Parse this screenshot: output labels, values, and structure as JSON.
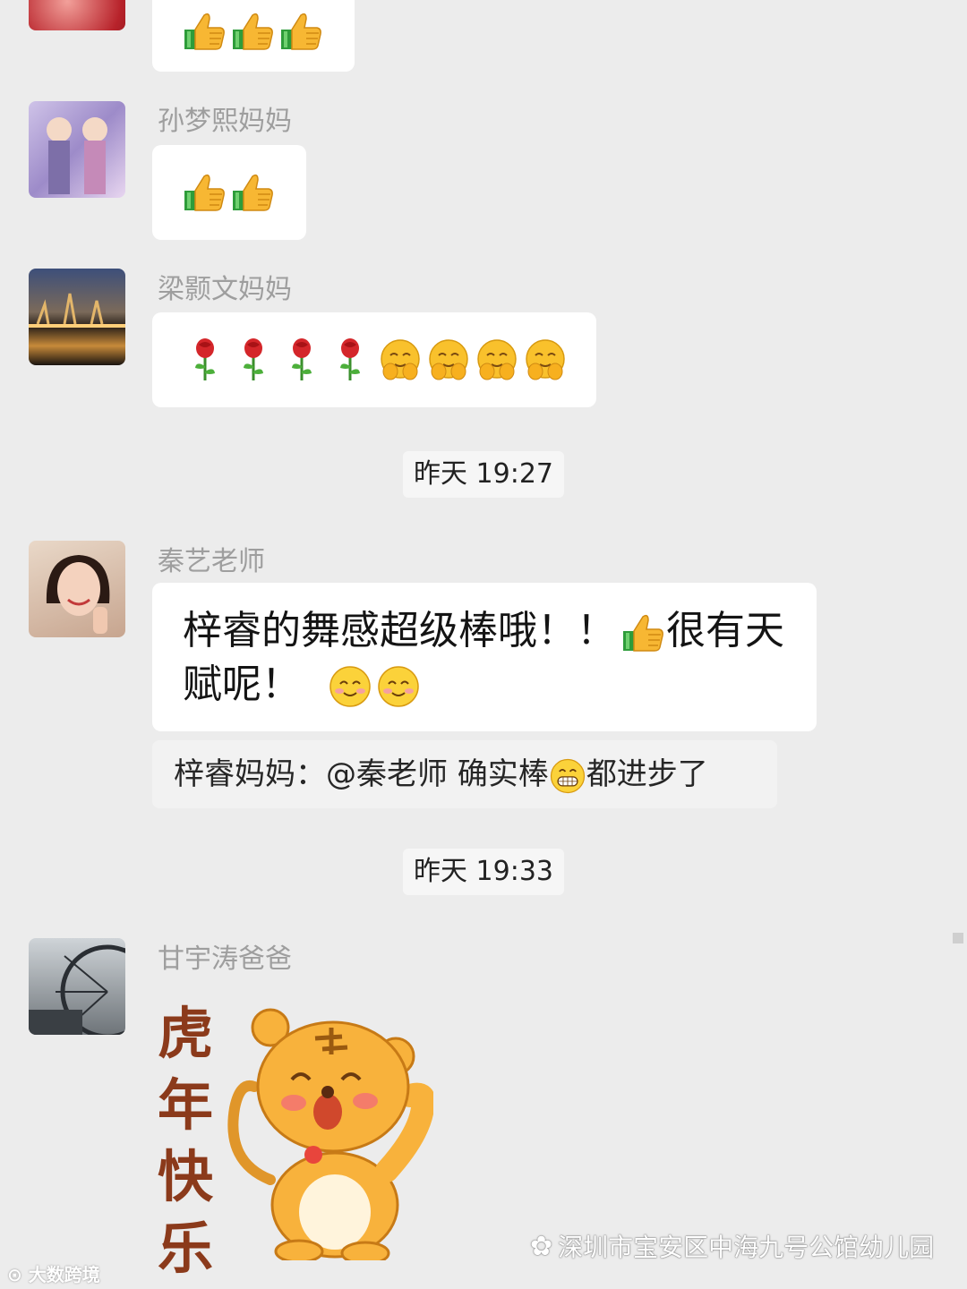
{
  "messages": [
    {
      "sender": "孙梦熙妈妈"
    },
    {
      "sender": "梁颢文妈妈"
    },
    {
      "time": "昨天 19:27"
    },
    {
      "sender": "秦艺老师",
      "text_line1": "梓睿的舞感超级棒哦！！",
      "text_line1b": "很有天",
      "text_line2": "赋呢！"
    },
    {
      "quote_prefix": "梓睿妈妈：@秦老师 确实棒",
      "quote_suffix": "都进步了"
    },
    {
      "time": "昨天 19:33"
    },
    {
      "sender": "甘宇涛爸爸",
      "sticker_chars": [
        "虎",
        "年",
        "快",
        "乐"
      ]
    }
  ],
  "watermark": {
    "text": "深圳市宝安区中海九号公馆幼儿园",
    "icon": "wechat-official-account-icon"
  },
  "corner_logo": {
    "text": "大数跨境"
  },
  "colors": {
    "background": "#ececec",
    "bubble": "#ffffff",
    "sender": "#9e9e9e",
    "sticker_text": "#8b3a1b"
  }
}
